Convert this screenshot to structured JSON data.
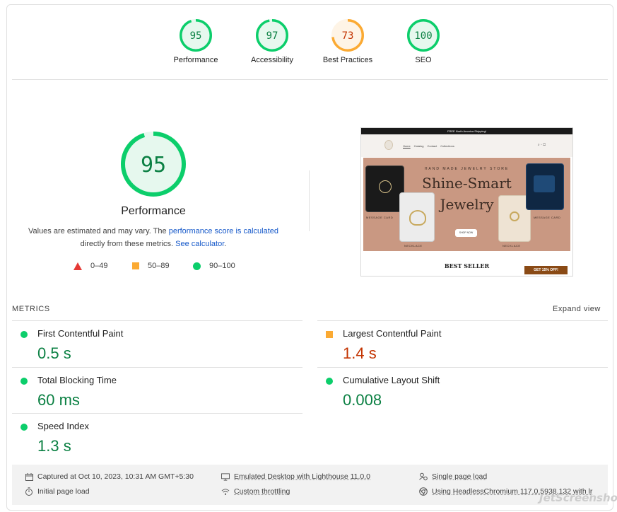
{
  "summary": [
    {
      "score": "95",
      "label": "Performance",
      "status": "pass",
      "fraction": 0.95
    },
    {
      "score": "97",
      "label": "Accessibility",
      "status": "pass",
      "fraction": 0.97
    },
    {
      "score": "73",
      "label": "Best Practices",
      "status": "average",
      "fraction": 0.73
    },
    {
      "score": "100",
      "label": "SEO",
      "status": "pass",
      "fraction": 1.0
    }
  ],
  "main": {
    "score": "95",
    "fraction": 0.95,
    "title": "Performance",
    "desc_part1": "Values are estimated and may vary. The ",
    "desc_link1": "performance score is calculated",
    "desc_part2": " directly from these metrics. ",
    "desc_link2": "See calculator",
    "desc_part3": "."
  },
  "legend": {
    "fail": "0–49",
    "average": "50–89",
    "pass": "90–100"
  },
  "screenshot": {
    "topbar": "FREE North America Shipping!",
    "nav_links": [
      "Home",
      "Catalog",
      "Contact",
      "Collections"
    ],
    "tagline": "HAND MADE JEWELRY STORE",
    "headline1": "Shine-Smart",
    "headline2": "Jewelry",
    "button": "SHOP NOW",
    "captions": [
      "MESSAGE CARD",
      "NECKLACE",
      "NECKLACE",
      "MESSAGE CARD"
    ],
    "best_seller": "BEST SELLER",
    "offer": "GET 15% OFF!"
  },
  "metrics": {
    "heading": "METRICS",
    "expand": "Expand view",
    "items": [
      {
        "name": "First Contentful Paint",
        "value": "0.5 s",
        "status": "pass"
      },
      {
        "name": "Largest Contentful Paint",
        "value": "1.4 s",
        "status": "average"
      },
      {
        "name": "Total Blocking Time",
        "value": "60 ms",
        "status": "pass"
      },
      {
        "name": "Cumulative Layout Shift",
        "value": "0.008",
        "status": "pass"
      },
      {
        "name": "Speed Index",
        "value": "1.3 s",
        "status": "pass"
      }
    ]
  },
  "footer": {
    "captured": "Captured at Oct 10, 2023, 10:31 AM GMT+5:30",
    "emulated": "Emulated Desktop with Lighthouse 11.0.0",
    "single": "Single page load",
    "initial": "Initial page load",
    "throttling": "Custom throttling",
    "browser": "Using HeadlessChromium 117.0.5938.132 with lr"
  },
  "watermark": "JetScreenshot",
  "colors": {
    "pass": "#0cce6b",
    "pass_text": "#0b8043",
    "pass_bg": "#e6f8ee",
    "average": "#fbaa33",
    "average_text": "#c33300",
    "average_bg": "#fef4e6",
    "fail": "#e53935",
    "link": "#1558c9"
  }
}
